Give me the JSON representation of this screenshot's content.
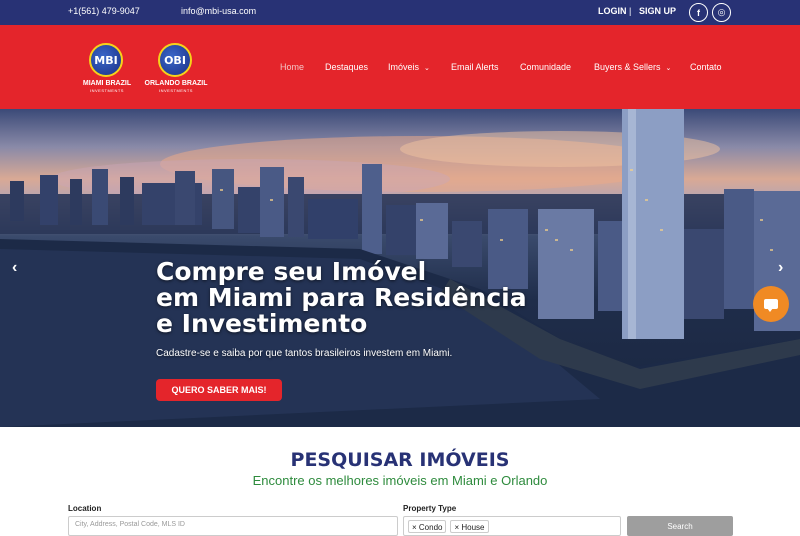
{
  "topbar": {
    "phone": "+1(561) 479-9047",
    "email": "info@mbi-usa.com",
    "login": "LOGIN",
    "separator": "|",
    "signup": "SIGN UP",
    "facebook_icon": "f",
    "instagram_icon": "◎"
  },
  "logos": {
    "miami": {
      "badge": "MBI",
      "name": "MIAMI BRAZIL",
      "sub": "INVESTMENTS"
    },
    "orlando": {
      "badge": "OBI",
      "name": "ORLANDO BRAZIL",
      "sub": "INVESTMENTS"
    }
  },
  "nav": {
    "home": "Home",
    "destaques": "Destaques",
    "imoveis": "Imóveis",
    "email_alerts": "Email Alerts",
    "comunidade": "Comunidade",
    "buyers_sellers": "Buyers & Sellers",
    "contato": "Contato",
    "caret": "⌄"
  },
  "hero": {
    "title_line1": "Compre seu Imóvel",
    "title_line2": "em Miami para Residência",
    "title_line3": "e Investimento",
    "subtitle": "Cadastre-se e saiba por que tantos brasileiros investem em Miami.",
    "cta": "QUERO SABER MAIS!",
    "prev_arrow": "‹",
    "next_arrow": "›"
  },
  "search": {
    "title": "PESQUISAR IMÓVEIS",
    "subtitle": "Encontre os melhores imóveis em Miami e Orlando",
    "location_label": "Location",
    "location_placeholder": "City, Address, Postal Code, MLS ID",
    "property_type_label": "Property Type",
    "tags": [
      "× Condo",
      "× House"
    ],
    "button": "Search"
  },
  "colors": {
    "topbar": "#283275",
    "navbar": "#e4252b",
    "title": "#283275",
    "subtitle": "#2e8b3d",
    "chat": "#f08a24"
  }
}
